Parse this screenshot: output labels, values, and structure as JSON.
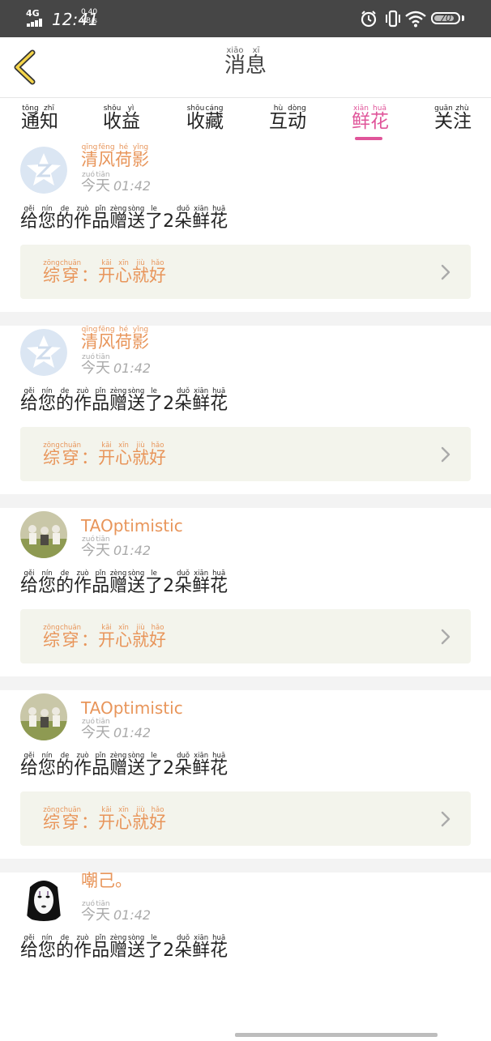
{
  "status_bar": {
    "network": "4G",
    "time": "12:41",
    "speed_value": "0.40",
    "speed_unit": "KB/s",
    "battery": "70"
  },
  "header": {
    "title_pinyin": [
      "xiāo",
      "xī"
    ],
    "title_chars": [
      "消",
      "息"
    ]
  },
  "tabs": [
    {
      "pinyin": [
        "tōng",
        "zhī"
      ],
      "chars": [
        "通",
        "知"
      ]
    },
    {
      "pinyin": [
        "shōu",
        "yì"
      ],
      "chars": [
        "收",
        "益"
      ]
    },
    {
      "pinyin": [
        "shōu",
        "cáng"
      ],
      "chars": [
        "收",
        "藏"
      ]
    },
    {
      "pinyin": [
        "hù",
        "dòng"
      ],
      "chars": [
        "互",
        "动"
      ]
    },
    {
      "pinyin": [
        "xiān",
        "huā"
      ],
      "chars": [
        "鲜",
        "花"
      ],
      "active": true
    },
    {
      "pinyin": [
        "guān",
        "zhù"
      ],
      "chars": [
        "关",
        "注"
      ]
    }
  ],
  "colors": {
    "accent": "#e0559a",
    "name": "#e8955a",
    "box": "#f3f4ec"
  },
  "messages": [
    {
      "user_pinyin": [
        "qīng",
        "fēng",
        "hé",
        "yǐng"
      ],
      "user_chars": [
        "清",
        "风",
        "荷",
        "影"
      ],
      "user_latin": "",
      "avatar": "default-star",
      "date_pinyin": [
        "zuó",
        "tiān"
      ],
      "date_chars": [
        "今",
        "天"
      ],
      "time": "01:42",
      "gift_pinyin": [
        "gěi",
        "nín",
        "de",
        "zuò",
        "pǐn",
        "zèng",
        "sòng",
        "le",
        "",
        "duǒ",
        "xiān",
        "huā"
      ],
      "gift_chars": [
        "给",
        "您",
        "的",
        "作",
        "品",
        "赠",
        "送",
        "了",
        "2",
        "朵",
        "鲜",
        "花"
      ],
      "work_pinyin": [
        "zōng",
        "chuān",
        "",
        "kāi",
        "xīn",
        "jiù",
        "hǎo"
      ],
      "work_chars": [
        "综",
        "穿",
        "：",
        "开",
        "心",
        "就",
        "好"
      ]
    },
    {
      "user_pinyin": [
        "qīng",
        "fēng",
        "hé",
        "yǐng"
      ],
      "user_chars": [
        "清",
        "风",
        "荷",
        "影"
      ],
      "user_latin": "",
      "avatar": "default-star",
      "date_pinyin": [
        "zuó",
        "tiān"
      ],
      "date_chars": [
        "今",
        "天"
      ],
      "time": "01:42",
      "gift_pinyin": [
        "gěi",
        "nín",
        "de",
        "zuò",
        "pǐn",
        "zèng",
        "sòng",
        "le",
        "",
        "duǒ",
        "xiān",
        "huā"
      ],
      "gift_chars": [
        "给",
        "您",
        "的",
        "作",
        "品",
        "赠",
        "送",
        "了",
        "2",
        "朵",
        "鲜",
        "花"
      ],
      "work_pinyin": [
        "zōng",
        "chuān",
        "",
        "kāi",
        "xīn",
        "jiù",
        "hǎo"
      ],
      "work_chars": [
        "综",
        "穿",
        "：",
        "开",
        "心",
        "就",
        "好"
      ]
    },
    {
      "user_pinyin": [],
      "user_chars": [],
      "user_latin": "TAOptimistic",
      "avatar": "photo-group",
      "date_pinyin": [
        "zuó",
        "tiān"
      ],
      "date_chars": [
        "今",
        "天"
      ],
      "time": "01:42",
      "gift_pinyin": [
        "gěi",
        "nín",
        "de",
        "zuò",
        "pǐn",
        "zèng",
        "sòng",
        "le",
        "",
        "duǒ",
        "xiān",
        "huā"
      ],
      "gift_chars": [
        "给",
        "您",
        "的",
        "作",
        "品",
        "赠",
        "送",
        "了",
        "2",
        "朵",
        "鲜",
        "花"
      ],
      "work_pinyin": [
        "zōng",
        "chuān",
        "",
        "kāi",
        "xīn",
        "jiù",
        "hǎo"
      ],
      "work_chars": [
        "综",
        "穿",
        "：",
        "开",
        "心",
        "就",
        "好"
      ]
    },
    {
      "user_pinyin": [],
      "user_chars": [],
      "user_latin": "TAOptimistic",
      "avatar": "photo-group",
      "date_pinyin": [
        "zuó",
        "tiān"
      ],
      "date_chars": [
        "今",
        "天"
      ],
      "time": "01:42",
      "gift_pinyin": [
        "gěi",
        "nín",
        "de",
        "zuò",
        "pǐn",
        "zèng",
        "sòng",
        "le",
        "",
        "duǒ",
        "xiān",
        "huā"
      ],
      "gift_chars": [
        "给",
        "您",
        "的",
        "作",
        "品",
        "赠",
        "送",
        "了",
        "2",
        "朵",
        "鲜",
        "花"
      ],
      "work_pinyin": [
        "zōng",
        "chuān",
        "",
        "kāi",
        "xīn",
        "jiù",
        "hǎo"
      ],
      "work_chars": [
        "综",
        "穿",
        "：",
        "开",
        "心",
        "就",
        "好"
      ]
    },
    {
      "user_pinyin": [
        "",
        ""
      ],
      "user_chars": [
        "嘲",
        "己",
        "。"
      ],
      "user_latin": "",
      "avatar": "noface-mask",
      "date_pinyin": [
        "zuó",
        "tiān"
      ],
      "date_chars": [
        "今",
        "天"
      ],
      "time": "01:42",
      "gift_pinyin": [
        "gěi",
        "nín",
        "de",
        "zuò",
        "pǐn",
        "zèng",
        "sòng",
        "le",
        "",
        "duǒ",
        "xiān",
        "huā"
      ],
      "gift_chars": [
        "给",
        "您",
        "的",
        "作",
        "品",
        "赠",
        "送",
        "了",
        "2",
        "朵",
        "鲜",
        "花"
      ],
      "work_pinyin": [],
      "work_chars": []
    }
  ]
}
